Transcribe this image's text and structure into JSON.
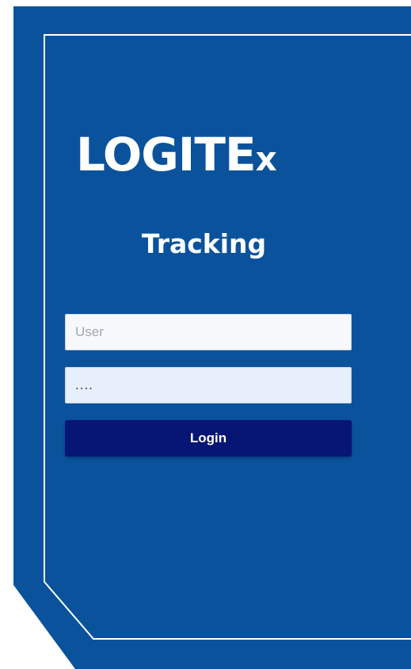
{
  "brand": {
    "logo_main": "LOGITE",
    "logo_sub": "x",
    "subtitle": "Tracking"
  },
  "login_form": {
    "user_placeholder": "User",
    "user_value": "",
    "password_value": "....",
    "login_label": "Login"
  },
  "colors": {
    "panel_blue": "#0a539c",
    "button_navy": "#071574",
    "text_white": "#ffffff"
  }
}
